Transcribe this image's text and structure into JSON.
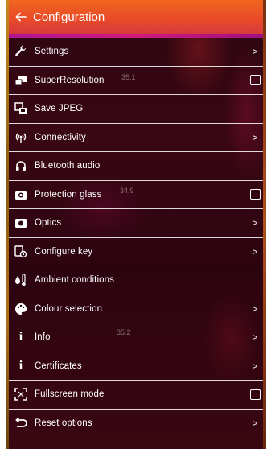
{
  "header": {
    "title": "Configuration",
    "back_icon": "arrow-left-icon"
  },
  "menu": {
    "items": [
      {
        "label": "Settings",
        "icon": "wrench-icon",
        "control": "chevron"
      },
      {
        "label": "SuperResolution",
        "icon": "superresolution-icon",
        "control": "checkbox",
        "checked": false
      },
      {
        "label": "Save JPEG",
        "icon": "save-jpeg-icon",
        "control": "none"
      },
      {
        "label": "Connectivity",
        "icon": "wireless-icon",
        "control": "chevron"
      },
      {
        "label": "Bluetooth audio",
        "icon": "headset-icon",
        "control": "none"
      },
      {
        "label": "Protection glass",
        "icon": "camera-icon",
        "control": "checkbox",
        "checked": false
      },
      {
        "label": "Optics",
        "icon": "lens-icon",
        "control": "chevron"
      },
      {
        "label": "Configure key",
        "icon": "key-config-icon",
        "control": "chevron"
      },
      {
        "label": "Ambient conditions",
        "icon": "ambient-icon",
        "control": "none"
      },
      {
        "label": "Colour selection",
        "icon": "palette-icon",
        "control": "chevron"
      },
      {
        "label": "Info",
        "icon": "info-icon",
        "control": "chevron"
      },
      {
        "label": "Certificates",
        "icon": "info-icon",
        "control": "chevron"
      },
      {
        "label": "Fullscreen mode",
        "icon": "fullscreen-icon",
        "control": "checkbox",
        "checked": false
      },
      {
        "label": "Reset options",
        "icon": "reset-icon",
        "control": "chevron"
      }
    ]
  },
  "overlay_temps": [
    "35.1",
    "34.9",
    "35.2"
  ],
  "chevron_glyph": ">",
  "colors": {
    "header_top": "#f0661f",
    "header_bottom": "#d53a3b",
    "background": "#2a0510",
    "text": "#ffffff"
  }
}
